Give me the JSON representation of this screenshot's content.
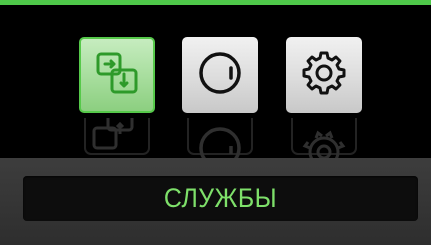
{
  "status_bar": {
    "color": "#4fc84a"
  },
  "menu": {
    "items": [
      {
        "id": "copy",
        "icon": "copy-swap-icon",
        "selected": true
      },
      {
        "id": "knob",
        "icon": "knob-icon",
        "selected": false
      },
      {
        "id": "settings",
        "icon": "gear-icon",
        "selected": false
      }
    ],
    "accent_color": "#56c94a"
  },
  "footer": {
    "label": "СЛУЖБЫ",
    "label_color": "#7ee06a"
  }
}
